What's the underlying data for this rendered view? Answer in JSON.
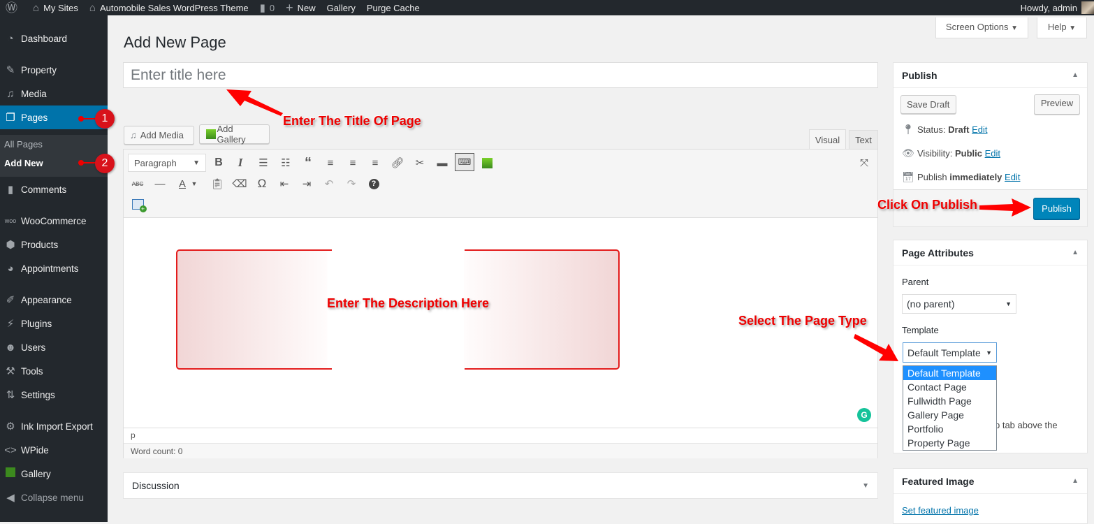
{
  "adminbar": {
    "my_sites": "My Sites",
    "site_name": "Automobile Sales WordPress Theme",
    "comments_count": "0",
    "new": "New",
    "gallery": "Gallery",
    "purge_cache": "Purge Cache",
    "howdy": "Howdy, admin"
  },
  "sidebar": {
    "items": [
      {
        "label": "Dashboard",
        "icon": "dashboard-icon"
      },
      {
        "label": "Property",
        "icon": "pin-icon"
      },
      {
        "label": "Media",
        "icon": "media-icon"
      },
      {
        "label": "Pages",
        "icon": "pages-icon"
      },
      {
        "label": "Comments",
        "icon": "comment-icon"
      },
      {
        "label": "WooCommerce",
        "icon": "woo-icon"
      },
      {
        "label": "Products",
        "icon": "box-icon"
      },
      {
        "label": "Appointments",
        "icon": "appointments-icon"
      },
      {
        "label": "Appearance",
        "icon": "brush-icon"
      },
      {
        "label": "Plugins",
        "icon": "plugin-icon"
      },
      {
        "label": "Users",
        "icon": "user-icon"
      },
      {
        "label": "Tools",
        "icon": "wrench-icon"
      },
      {
        "label": "Settings",
        "icon": "settings-icon"
      },
      {
        "label": "Ink Import Export",
        "icon": "gear-icon"
      },
      {
        "label": "WPide",
        "icon": "code-icon"
      },
      {
        "label": "Gallery",
        "icon": "gallery-icon"
      },
      {
        "label": "Collapse menu",
        "icon": "collapse-icon"
      }
    ],
    "submenu": [
      "All Pages",
      "Add New"
    ]
  },
  "header": {
    "screen_options": "Screen Options",
    "help": "Help",
    "page_title": "Add New Page",
    "title_placeholder": "Enter title here"
  },
  "editor": {
    "add_media": "Add Media",
    "add_gallery": "Add Gallery",
    "tab_visual": "Visual",
    "tab_text": "Text",
    "format_select": "Paragraph",
    "path": "p",
    "word_count": "Word count: 0"
  },
  "discussion": {
    "title": "Discussion"
  },
  "publish": {
    "title": "Publish",
    "save_draft": "Save Draft",
    "preview": "Preview",
    "status_label": "Status:",
    "status_value": "Draft",
    "visibility_label": "Visibility:",
    "visibility_value": "Public",
    "publish_label": "Publish",
    "publish_value": "immediately",
    "edit": "Edit",
    "publish_button": "Publish"
  },
  "page_attributes": {
    "title": "Page Attributes",
    "parent_label": "Parent",
    "parent_value": "(no parent)",
    "template_label": "Template",
    "template_value": "Default Template",
    "template_options": [
      "Default Template",
      "Contact Page",
      "Fullwidth Page",
      "Gallery Page",
      "Portfolio",
      "Property Page"
    ],
    "help_text_fragment": "p tab above the"
  },
  "featured_image": {
    "title": "Featured Image",
    "set_link": "Set featured image"
  },
  "annotations": {
    "title": "Enter The Title Of Page",
    "description": "Enter The Description Here",
    "publish": "Click On Publish",
    "page_type": "Select The Page Type",
    "step1": "1",
    "step2": "2"
  }
}
